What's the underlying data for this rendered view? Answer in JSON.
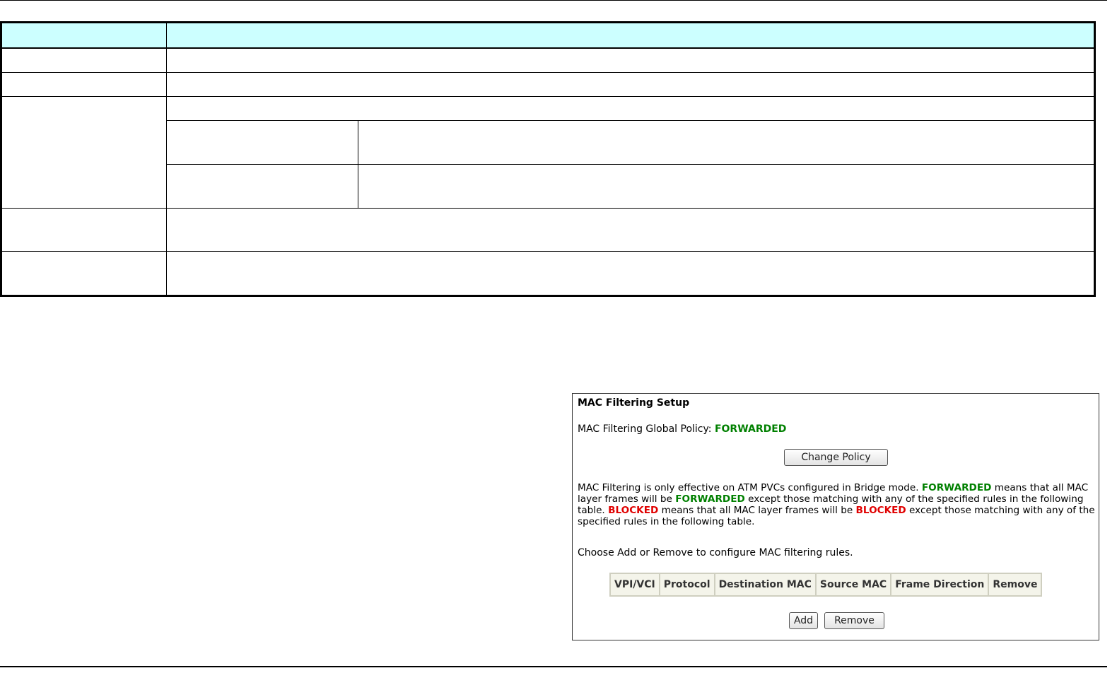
{
  "mac_panel": {
    "title": "MAC Filtering Setup",
    "policy_label": "MAC Filtering Global Policy:",
    "policy_value": "FORWARDED",
    "change_policy_button": "Change Policy",
    "description": {
      "part1": "MAC Filtering is only effective on ATM PVCs configured in Bridge mode.",
      "forwarded1": "FORWARDED",
      "part2": "means that all MAC layer frames will be",
      "forwarded2": "FORWARDED",
      "part3": "except those matching with any of the specified rules in the following table.",
      "blocked1": "BLOCKED",
      "part4": "means that all MAC layer frames will be",
      "blocked2": "BLOCKED",
      "part5": "except those matching with any of the specified rules in the following table."
    },
    "instruction": "Choose Add or Remove to configure MAC filtering rules.",
    "table_headers": [
      "VPI/VCI",
      "Protocol",
      "Destination MAC",
      "Source MAC",
      "Frame Direction",
      "Remove"
    ],
    "add_button": "Add",
    "remove_button": "Remove",
    "colors": {
      "forwarded": "#008000",
      "blocked": "#e00000",
      "table_bg": "#f4f4ea"
    }
  }
}
